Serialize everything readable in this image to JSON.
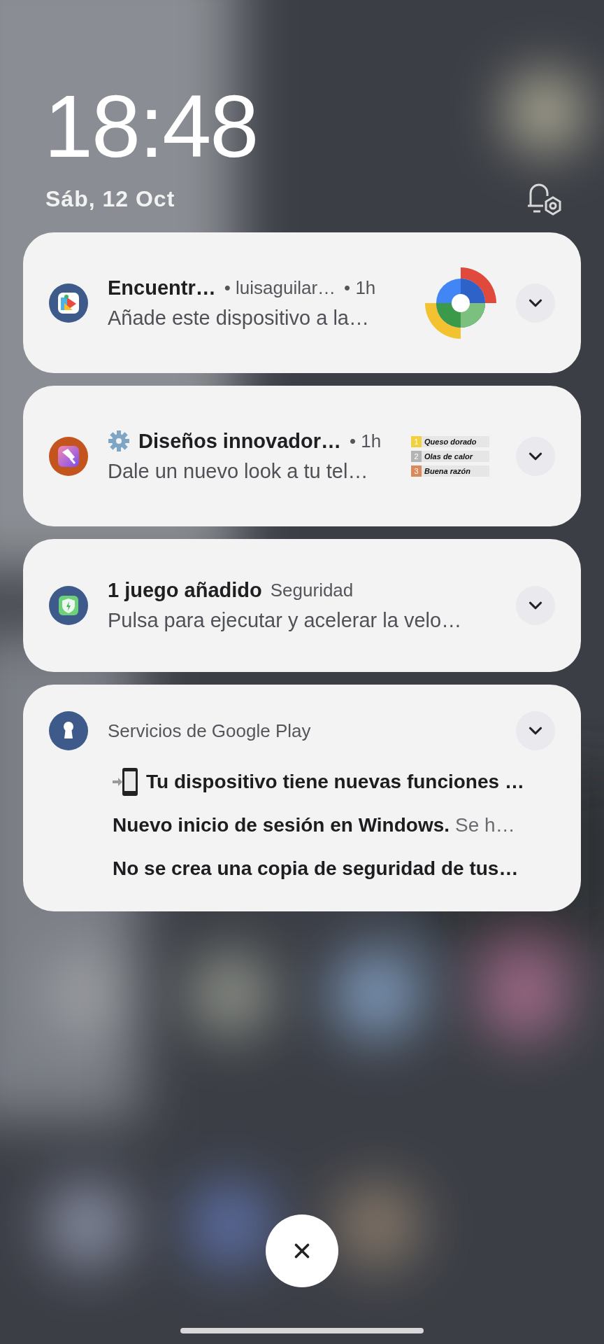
{
  "clock": {
    "time": "18:48",
    "date": "Sáb, 12 Oct"
  },
  "notifications": [
    {
      "kind": "device_finder",
      "title": "Encuentr…",
      "account": "• luisaguilar…",
      "time": "• 1h",
      "body": "Añade este dispositivo a la…",
      "expanded": false
    },
    {
      "kind": "theme",
      "title": "Diseños innovador…",
      "time": "• 1h",
      "body": "Dale un nuevo look a tu tel…",
      "expanded": false,
      "thumbnail_items": [
        {
          "number": "1",
          "label": "Queso dorado",
          "color": "#f2d23c"
        },
        {
          "number": "2",
          "label": "Olas de calor",
          "color": "#b4b4b4"
        },
        {
          "number": "3",
          "label": "Buena razón",
          "color": "#d9895a"
        }
      ]
    },
    {
      "kind": "security",
      "title": "1 juego añadido",
      "app": "Seguridad",
      "body": "Pulsa para ejecutar y acelerar la velo…",
      "expanded": false
    },
    {
      "kind": "group",
      "app": "Servicios de Google Play",
      "expanded": false,
      "messages": [
        {
          "kind": "device",
          "title": "Tu dispositivo tiene nuevas funciones …"
        },
        {
          "kind": "plain",
          "title": "Nuevo inicio de sesión en Windows.",
          "body": "Se h…"
        },
        {
          "kind": "plain",
          "title": "No se crea una copia de seguridad de tus…"
        }
      ]
    }
  ]
}
